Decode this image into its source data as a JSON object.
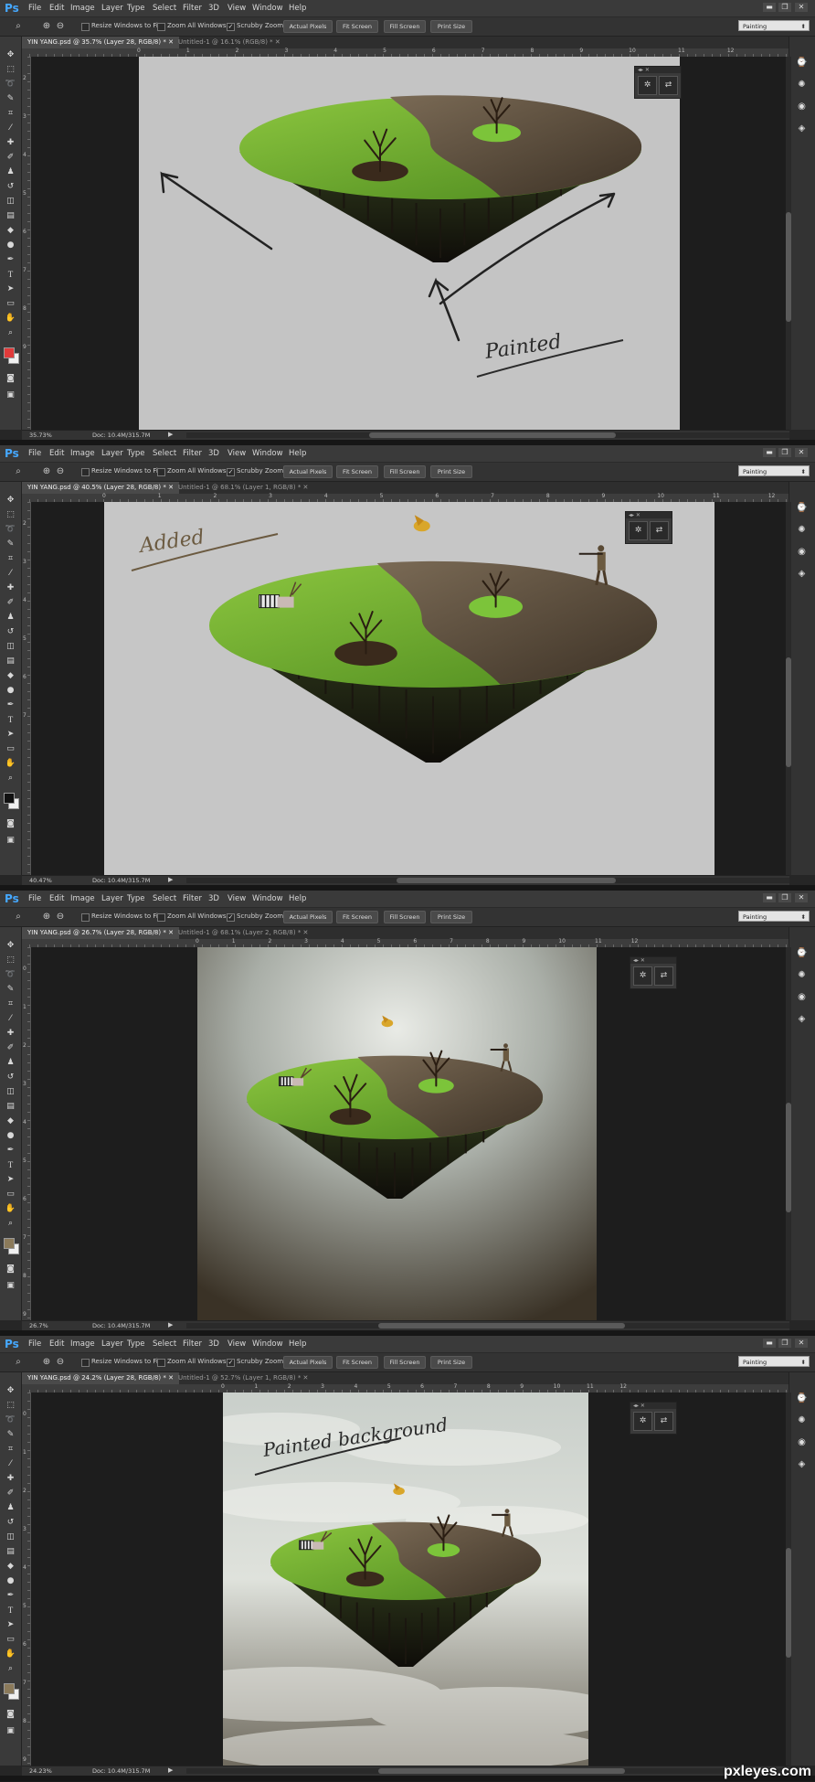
{
  "menu": {
    "logo": "Ps",
    "items": [
      "File",
      "Edit",
      "Image",
      "Layer",
      "Type",
      "Select",
      "Filter",
      "3D",
      "View",
      "Window",
      "Help"
    ]
  },
  "options": {
    "resize_windows": "Resize Windows to Fit",
    "zoom_all": "Zoom All Windows",
    "scrubby_zoom": "Scrubby Zoom",
    "actual_pixels": "Actual Pixels",
    "fit_screen": "Fit Screen",
    "fill_screen": "Fill Screen",
    "print_size": "Print Size",
    "workspace": "Painting"
  },
  "panels": [
    {
      "active_tab": "YIN YANG.psd @ 35.7% (Layer 28, RGB/8) *",
      "inactive_tab": "Untitled-1 @ 16.1% (RGB/8) *",
      "zoom": "35.73%",
      "docsize": "Doc: 10.4M/315.7M",
      "annotation": "Painted",
      "ruler_h": [
        "0",
        "1",
        "2",
        "3",
        "4",
        "5",
        "6",
        "7",
        "8",
        "9",
        "10",
        "11",
        "12"
      ],
      "ruler_v": [
        "2",
        "3",
        "4",
        "5",
        "6",
        "7",
        "8",
        "9"
      ],
      "fg_color": "#e03a3a"
    },
    {
      "active_tab": "YIN YANG.psd @ 40.5% (Layer 28, RGB/8) *",
      "inactive_tab": "Untitled-1 @ 68.1% (Layer 1, RGB/8) *",
      "zoom": "40.47%",
      "docsize": "Doc: 10.4M/315.7M",
      "annotation": "Added",
      "ruler_h": [
        "0",
        "1",
        "2",
        "3",
        "4",
        "5",
        "6",
        "7",
        "8",
        "9",
        "10",
        "11",
        "12"
      ],
      "ruler_v": [
        "2",
        "3",
        "4",
        "5",
        "6",
        "7"
      ],
      "fg_color": "#111111"
    },
    {
      "active_tab": "YIN YANG.psd @ 26.7% (Layer 28, RGB/8) *",
      "inactive_tab": "Untitled-1 @ 68.1% (Layer 2, RGB/8) *",
      "zoom": "26.7%",
      "docsize": "Doc: 10.4M/315.7M",
      "annotation": "",
      "ruler_h": [
        "0",
        "1",
        "2",
        "3",
        "4",
        "5",
        "6",
        "7",
        "8",
        "9",
        "10",
        "11",
        "12"
      ],
      "ruler_v": [
        "0",
        "1",
        "2",
        "3",
        "4",
        "5",
        "6",
        "7",
        "8",
        "9"
      ],
      "fg_color": "#8b7a5a"
    },
    {
      "active_tab": "YIN YANG.psd @ 24.2% (Layer 28, RGB/8) *",
      "inactive_tab": "Untitled-1 @ 52.7% (Layer 1, RGB/8) *",
      "zoom": "24.23%",
      "docsize": "Doc: 10.4M/315.7M",
      "annotation": "Painted background",
      "ruler_h": [
        "0",
        "1",
        "2",
        "3",
        "4",
        "5",
        "6",
        "7",
        "8",
        "9",
        "10",
        "11",
        "12"
      ],
      "ruler_v": [
        "0",
        "1",
        "2",
        "3",
        "4",
        "5",
        "6",
        "7",
        "8",
        "9"
      ],
      "fg_color": "#8b7a5a"
    }
  ],
  "watermark": "pxleyes.com",
  "icons": [
    "zoom-icon",
    "zoom-in-icon",
    "zoom-out-icon",
    "move-icon",
    "marquee-icon",
    "lasso-icon",
    "crop-icon",
    "brush-icon",
    "eraser-icon",
    "hand-icon",
    "swatches-icon",
    "layers-icon"
  ]
}
